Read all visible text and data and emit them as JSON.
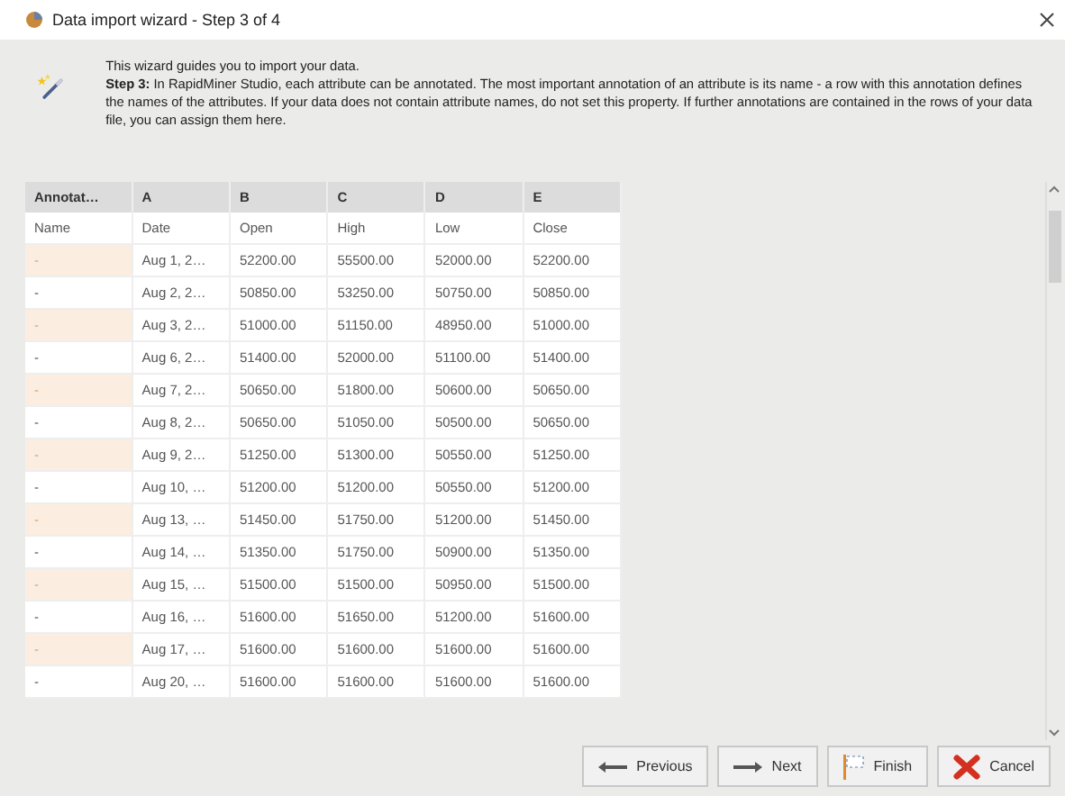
{
  "window": {
    "title": "Data import wizard - Step 3 of 4"
  },
  "intro": {
    "line1": "This wizard guides you to import your data.",
    "text": "**Step 3:** In RapidMiner Studio, each attribute can be annotated. The most important annotation of an attribute is its name - a row with this annotation defines the names of the attributes. If your data does not contain attribute names, do not set this property. If further annotations are contained in the rows of your data file, you can assign them here."
  },
  "table": {
    "columns": [
      "Annotat…",
      "A",
      "B",
      "C",
      "D",
      "E"
    ],
    "rows": [
      [
        "Name",
        "Date",
        "Open",
        "High",
        "Low",
        "Close"
      ],
      [
        "-",
        "Aug 1, 2…",
        "52200.00",
        "55500.00",
        "52000.00",
        "52200.00"
      ],
      [
        "-",
        "Aug 2, 2…",
        "50850.00",
        "53250.00",
        "50750.00",
        "50850.00"
      ],
      [
        "-",
        "Aug 3, 2…",
        "51000.00",
        "51150.00",
        "48950.00",
        "51000.00"
      ],
      [
        "-",
        "Aug 6, 2…",
        "51400.00",
        "52000.00",
        "51100.00",
        "51400.00"
      ],
      [
        "-",
        "Aug 7, 2…",
        "50650.00",
        "51800.00",
        "50600.00",
        "50650.00"
      ],
      [
        "-",
        "Aug 8, 2…",
        "50650.00",
        "51050.00",
        "50500.00",
        "50650.00"
      ],
      [
        "-",
        "Aug 9, 2…",
        "51250.00",
        "51300.00",
        "50550.00",
        "51250.00"
      ],
      [
        "-",
        "Aug 10, …",
        "51200.00",
        "51200.00",
        "50550.00",
        "51200.00"
      ],
      [
        "-",
        "Aug 13, …",
        "51450.00",
        "51750.00",
        "51200.00",
        "51450.00"
      ],
      [
        "-",
        "Aug 14, …",
        "51350.00",
        "51750.00",
        "50900.00",
        "51350.00"
      ],
      [
        "-",
        "Aug 15, …",
        "51500.00",
        "51500.00",
        "50950.00",
        "51500.00"
      ],
      [
        "-",
        "Aug 16, …",
        "51600.00",
        "51650.00",
        "51200.00",
        "51600.00"
      ],
      [
        "-",
        "Aug 17, …",
        "51600.00",
        "51600.00",
        "51600.00",
        "51600.00"
      ],
      [
        "-",
        "Aug 20, …",
        "51600.00",
        "51600.00",
        "51600.00",
        "51600.00"
      ]
    ]
  },
  "buttons": [
    {
      "kind": "previous",
      "label": "Previous"
    },
    {
      "kind": "next",
      "label": "Next"
    },
    {
      "kind": "finish",
      "label": "Finish"
    },
    {
      "kind": "cancel",
      "label": "Cancel"
    }
  ]
}
